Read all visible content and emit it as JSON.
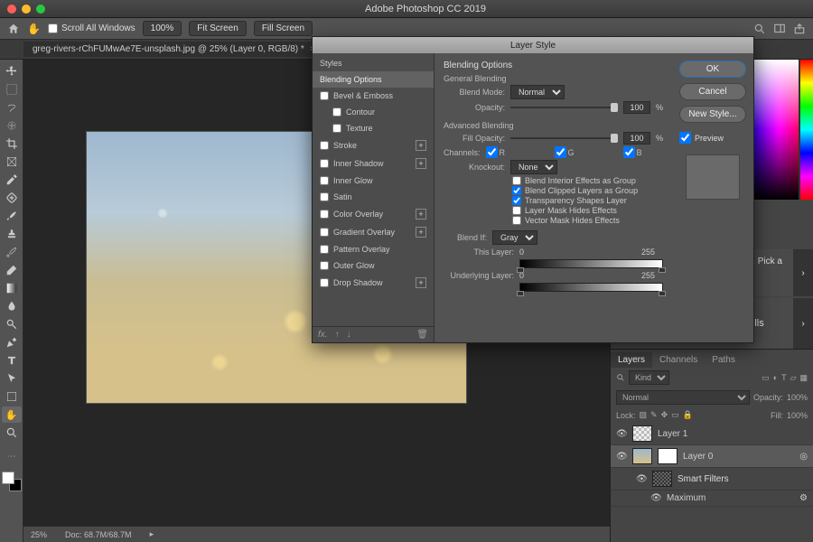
{
  "app": {
    "title": "Adobe Photoshop CC 2019"
  },
  "options_bar": {
    "scroll_all": "Scroll All Windows",
    "zoom_label": "100%",
    "fit_screen": "Fit Screen",
    "fill_screen": "Fill Screen"
  },
  "doc_tab": {
    "name": "greg-rivers-rChFUMwAe7E-unsplash.jpg @ 25% (Layer 0, RGB/8) *"
  },
  "status": {
    "zoom": "25%",
    "doc_info": "Doc: 68.7M/68.7M"
  },
  "learn_card": {
    "subhead": "pp. Pick a",
    "title": "Fundamental Skills"
  },
  "panel_tabs": [
    "Layers",
    "Channels",
    "Paths"
  ],
  "layers_panel": {
    "kind_label": "Kind",
    "blend": "Normal",
    "opacity_label": "Opacity:",
    "opacity_value": "100%",
    "lock_label": "Lock:",
    "fill_label": "Fill:",
    "fill_value": "100%",
    "items": [
      {
        "name": "Layer 1"
      },
      {
        "name": "Layer 0",
        "active": true
      },
      {
        "name": "Smart Filters",
        "sub": true
      },
      {
        "name": "Maximum",
        "sub": true,
        "leaf": true
      }
    ]
  },
  "modal": {
    "title": "Layer Style",
    "left_header": "Styles",
    "effects": [
      {
        "label": "Blending Options",
        "section": true,
        "active": true
      },
      {
        "label": "Bevel & Emboss",
        "checkbox": true
      },
      {
        "label": "Contour",
        "checkbox": true,
        "indent": true
      },
      {
        "label": "Texture",
        "checkbox": true,
        "indent": true
      },
      {
        "label": "Stroke",
        "checkbox": true,
        "plus": true
      },
      {
        "label": "Inner Shadow",
        "checkbox": true,
        "plus": true
      },
      {
        "label": "Inner Glow",
        "checkbox": true
      },
      {
        "label": "Satin",
        "checkbox": true
      },
      {
        "label": "Color Overlay",
        "checkbox": true,
        "plus": true
      },
      {
        "label": "Gradient Overlay",
        "checkbox": true,
        "plus": true
      },
      {
        "label": "Pattern Overlay",
        "checkbox": true
      },
      {
        "label": "Outer Glow",
        "checkbox": true
      },
      {
        "label": "Drop Shadow",
        "checkbox": true,
        "plus": true
      }
    ],
    "center": {
      "title": "Blending Options",
      "general_hdr": "General Blending",
      "blend_mode_lbl": "Blend Mode:",
      "blend_mode": "Normal",
      "opacity_lbl": "Opacity:",
      "opacity_val": "100",
      "pct": "%",
      "advanced_hdr": "Advanced Blending",
      "fill_opacity_lbl": "Fill Opacity:",
      "fill_opacity_val": "100",
      "channels_lbl": "Channels:",
      "ch_r": "R",
      "ch_g": "G",
      "ch_b": "B",
      "knockout_lbl": "Knockout:",
      "knockout": "None",
      "opts": [
        {
          "label": "Blend Interior Effects as Group",
          "checked": false
        },
        {
          "label": "Blend Clipped Layers as Group",
          "checked": true
        },
        {
          "label": "Transparency Shapes Layer",
          "checked": true
        },
        {
          "label": "Layer Mask Hides Effects",
          "checked": false
        },
        {
          "label": "Vector Mask Hides Effects",
          "checked": false
        }
      ],
      "blendif_lbl": "Blend If:",
      "blendif_mode": "Gray",
      "this_layer_lbl": "This Layer:",
      "this_min": "0",
      "this_max": "255",
      "under_lbl": "Underlying Layer:",
      "under_min": "0",
      "under_max": "255"
    },
    "buttons": {
      "ok": "OK",
      "cancel": "Cancel",
      "newstyle": "New Style...",
      "preview": "Preview"
    }
  },
  "colors": {
    "accent": "#2a6fb5"
  }
}
